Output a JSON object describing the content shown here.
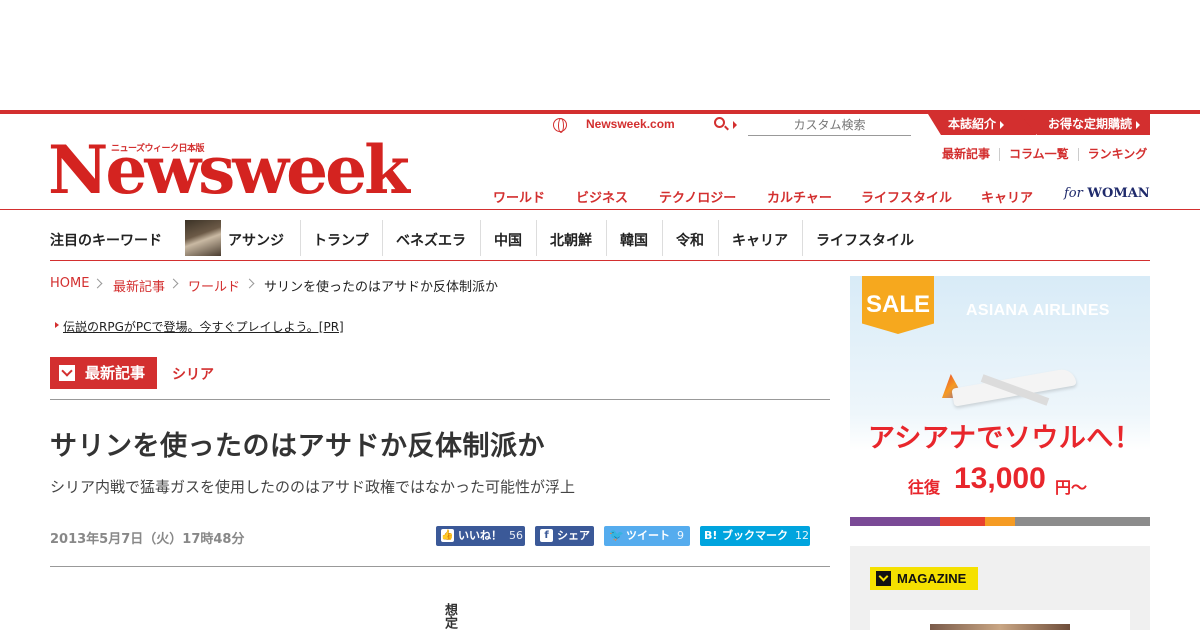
{
  "header": {
    "logo_sub": "ニューズウィーク日本版",
    "logo": "Newsweek",
    "site_link": "Newsweek.com",
    "search_placeholder": "カスタム検索",
    "pill_about": "本誌紹介",
    "pill_subscribe": "お得な定期購読",
    "sublinks": [
      "最新記事",
      "コラム一覧",
      "ランキング"
    ],
    "nav": [
      "ワールド",
      "ビジネス",
      "テクノロジー",
      "カルチャー",
      "ライフスタイル",
      "キャリア"
    ],
    "for_woman_prefix": "for",
    "for_woman": "WOMAN"
  },
  "keywords": {
    "title": "注目のキーワード",
    "items": [
      "アサンジ",
      "トランプ",
      "ベネズエラ",
      "中国",
      "北朝鮮",
      "韓国",
      "令和",
      "キャリア",
      "ライフスタイル"
    ]
  },
  "breadcrumb": [
    "HOME",
    "最新記事",
    "ワールド",
    "サリンを使ったのはアサドか反体制派か"
  ],
  "pr_link": "伝説のRPGがPCで登場。今すぐプレイしよう。[PR]",
  "category": {
    "badge": "最新記事",
    "sub": "シリア"
  },
  "article": {
    "headline": "サリンを使ったのはアサドか反体制派か",
    "subhead": "シリア内戦で猛毒ガスを使用したののはアサド政権ではなかった可能性が浮上",
    "date": "2013年5月7日（火）17時48分",
    "body_start": "想定"
  },
  "share": {
    "like_label": "いいね！",
    "like_count": "56",
    "share_label": "シェア",
    "tweet_label": "ツイート",
    "tweet_count": "9",
    "bookmark_label": "ブックマーク",
    "bookmark_count": "12"
  },
  "ad": {
    "sale": "SALE",
    "brand": "ASIANA AIRLINES",
    "headline": "アシアナでソウルへ！",
    "price_label": "往復",
    "price": "13,000",
    "price_unit": "円〜"
  },
  "magazine": {
    "badge": "MAGAZINE"
  },
  "colors": {
    "brand_red": "#d32f2f",
    "facebook": "#3b5998",
    "twitter": "#55acee",
    "hatena": "#00a4de",
    "magazine_yellow": "#f5e100"
  }
}
